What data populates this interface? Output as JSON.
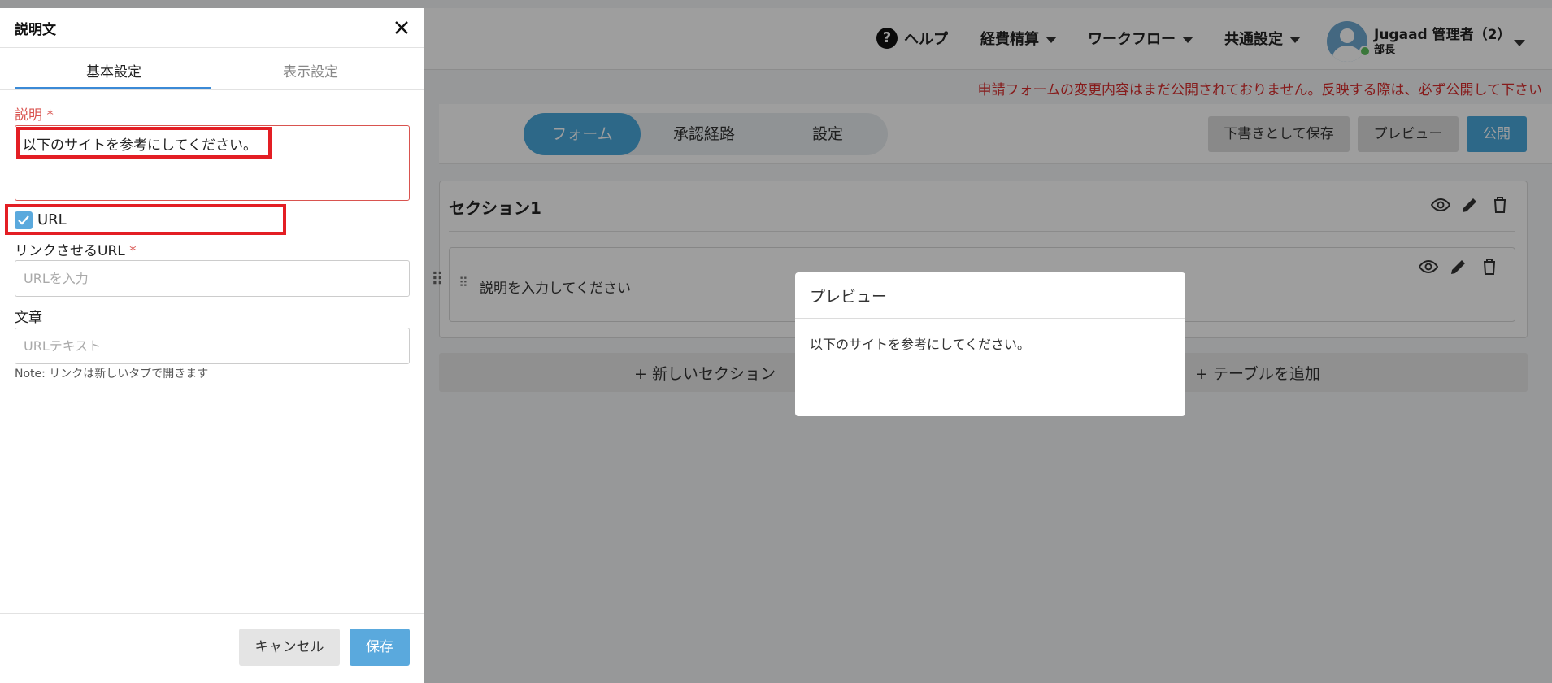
{
  "header": {
    "help_label": "ヘルプ",
    "nav": [
      "経費精算",
      "ワークフロー",
      "共通設定"
    ],
    "user_name": "Jugaad 管理者（2）",
    "user_role": "部長"
  },
  "notice": "申請フォームの変更内容はまだ公開されておりません。反映する際は、必ず公開して下さい",
  "editor_tabs": [
    "フォーム",
    "承認経路",
    "設定"
  ],
  "editor_tabs_active": "フォーム",
  "actions": {
    "draft": "下書きとして保存",
    "preview": "プレビュー",
    "publish": "公開"
  },
  "section": {
    "title": "セクション1",
    "field_text": "説明を入力してください",
    "add_section": "+  新しいセクション",
    "add_table": "+  テーブルを追加"
  },
  "preview_modal": {
    "title": "プレビュー",
    "body": "以下のサイトを参考にしてください。"
  },
  "panel": {
    "title": "説明文",
    "tabs": [
      "基本設定",
      "表示設定"
    ],
    "description_label": "説明",
    "description_value": "以下のサイトを参考にしてください。",
    "url_checkbox_label": "URL",
    "url_checked": true,
    "link_url_label": "リンクさせるURL",
    "link_url_placeholder": "URLを入力",
    "text_label": "文章",
    "text_placeholder": "URLテキスト",
    "note": "Note: リンクは新しいタブで開きます",
    "cancel": "キャンセル",
    "save": "保存",
    "required_mark": "*"
  },
  "colors": {
    "accent": "#4aa8dc",
    "error": "#d9534f",
    "highlight": "#e31e24"
  }
}
